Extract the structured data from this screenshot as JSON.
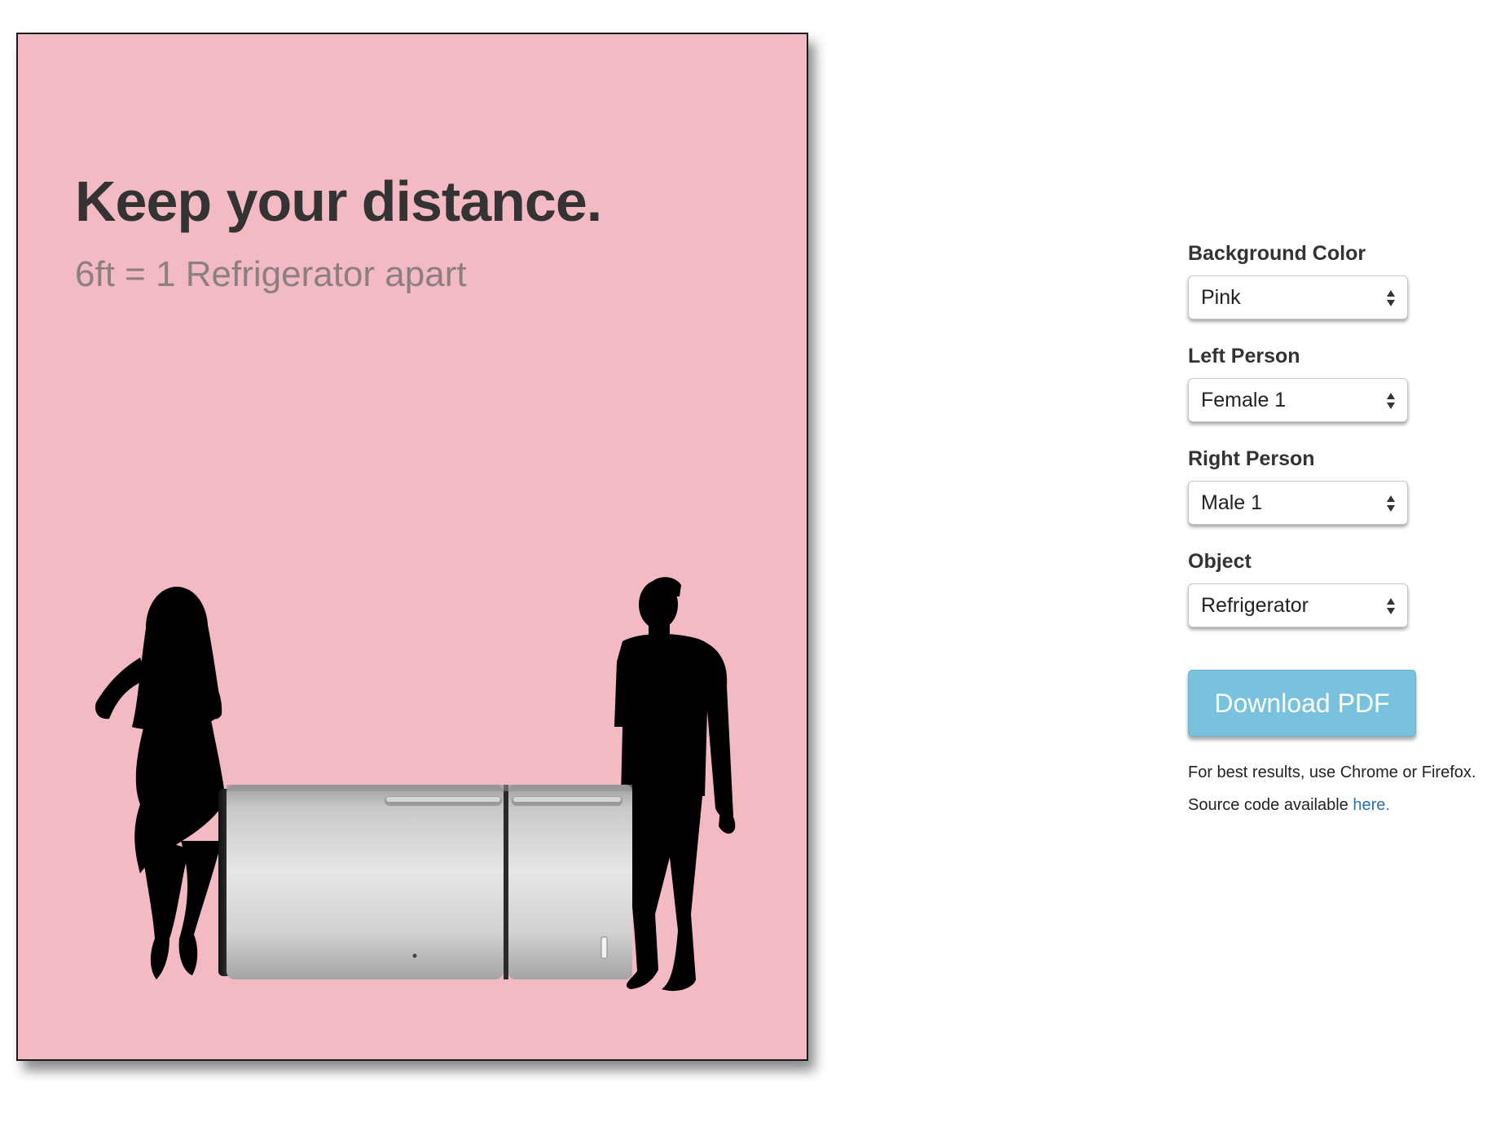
{
  "poster": {
    "title": "Keep your distance.",
    "subtitle": "6ft = 1 Refrigerator apart",
    "background_color": "#f4bac3",
    "left_person_icon": "female-silhouette",
    "right_person_icon": "male-silhouette",
    "object_icon": "refrigerator"
  },
  "controls": {
    "background_color": {
      "label": "Background Color",
      "value": "Pink"
    },
    "left_person": {
      "label": "Left Person",
      "value": "Female 1"
    },
    "right_person": {
      "label": "Right Person",
      "value": "Male 1"
    },
    "object": {
      "label": "Object",
      "value": "Refrigerator"
    },
    "download_label": "Download PDF",
    "note_best_results": "For best results, use Chrome or Firefox.",
    "note_source_prefix": "Source code available ",
    "note_source_link": "here.",
    "accent_color": "#79c2de",
    "link_color": "#2a6fb3"
  }
}
